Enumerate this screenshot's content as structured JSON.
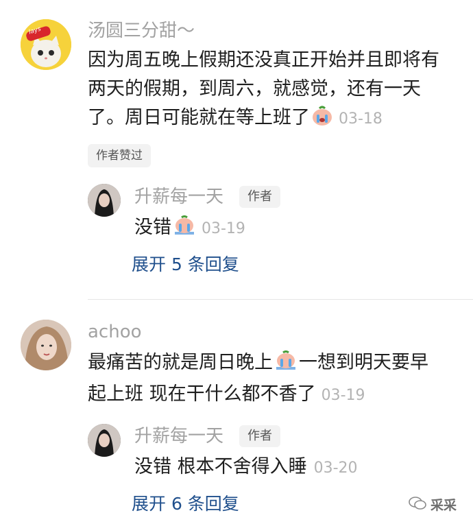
{
  "comments": [
    {
      "username": "汤圆三分甜～",
      "text_lines": [
        "因为周五晚上假期还没真正开始并且即将有",
        "两天的假期，到周六，就感觉，还有一天",
        "了。周日可能就在等上班了"
      ],
      "date": "03-18",
      "author_liked": "作者赞过",
      "reply": {
        "username": "升薪每一天",
        "badge": "作者",
        "text": "没错",
        "date": "03-19"
      },
      "expand_label": "展开 5 条回复"
    },
    {
      "username": "achoo",
      "text_lines": [
        "最痛苦的就是周日晚上",
        "一想到明天要早",
        "起上班 现在干什么都不香了"
      ],
      "date": "03-19",
      "reply": {
        "username": "升薪每一天",
        "badge": "作者",
        "text": "没错 根本不舍得入睡",
        "date": "03-20"
      },
      "expand_label": "展开 6 条回复"
    }
  ],
  "watermark": "采采",
  "avatar_badge_text": "lays"
}
